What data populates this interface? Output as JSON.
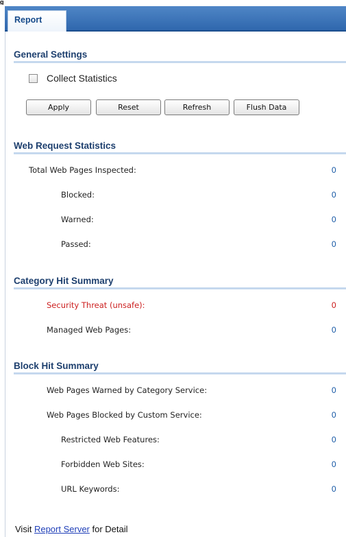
{
  "tabs": [
    {
      "label": "Report"
    }
  ],
  "general_settings": {
    "title": "General Settings",
    "collect_statistics": {
      "label": "Collect Statistics",
      "checked": false
    },
    "buttons": {
      "apply": "Apply",
      "reset": "Reset",
      "refresh": "Refresh",
      "flush": "Flush Data"
    }
  },
  "web_request_statistics": {
    "title": "Web Request Statistics",
    "rows": [
      {
        "label": "Total Web Pages Inspected:",
        "value": "0"
      },
      {
        "label": "Blocked:",
        "value": "0"
      },
      {
        "label": "Warned:",
        "value": "0"
      },
      {
        "label": "Passed:",
        "value": "0"
      }
    ]
  },
  "category_hit_summary": {
    "title": "Category Hit Summary",
    "rows": [
      {
        "label": "Security Threat (unsafe):",
        "value": "0",
        "color": "#cc2020"
      },
      {
        "label": "Managed Web Pages:",
        "value": "0"
      }
    ]
  },
  "block_hit_summary": {
    "title": "Block Hit Summary",
    "rows": [
      {
        "label": "Web Pages Warned by Category Service:",
        "value": "0"
      },
      {
        "label": "Web Pages Blocked by Custom Service:",
        "value": "0"
      },
      {
        "label": "Restricted Web Features:",
        "value": "0"
      },
      {
        "label": "Forbidden Web Sites:",
        "value": "0"
      },
      {
        "label": "URL Keywords:",
        "value": "0"
      }
    ]
  },
  "footer": {
    "prefix": "Visit",
    "link": "Report Server",
    "suffix": "for Detail"
  },
  "colors": {
    "tab_bar": "#2f67ad",
    "section_title": "#1d3f6e",
    "value": "#1f5ea8",
    "threat": "#cc2020"
  }
}
